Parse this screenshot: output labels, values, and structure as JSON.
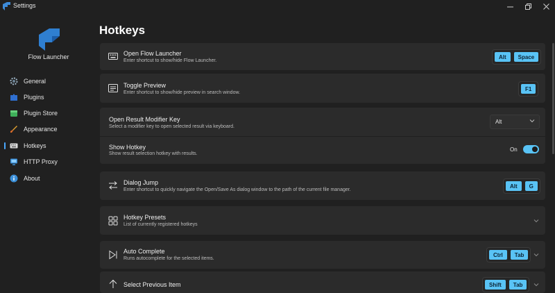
{
  "window": {
    "title": "Settings"
  },
  "sidebar": {
    "app_name": "Flow Launcher",
    "items": [
      {
        "label": "General",
        "icon": "gear-icon"
      },
      {
        "label": "Plugins",
        "icon": "puzzle-icon"
      },
      {
        "label": "Plugin Store",
        "icon": "store-icon"
      },
      {
        "label": "Appearance",
        "icon": "paintbrush-icon"
      },
      {
        "label": "Hotkeys",
        "icon": "keyboard-icon",
        "selected": true
      },
      {
        "label": "HTTP Proxy",
        "icon": "network-icon"
      },
      {
        "label": "About",
        "icon": "info-icon"
      }
    ]
  },
  "page": {
    "title": "Hotkeys"
  },
  "settings": {
    "open_flow": {
      "title": "Open Flow Launcher",
      "desc": "Enter shortcut to show/hide Flow Launcher.",
      "keys": [
        "Alt",
        "Space"
      ]
    },
    "toggle_preview": {
      "title": "Toggle Preview",
      "desc": "Enter shortcut to show/hide preview in search window.",
      "keys": [
        "F1"
      ]
    },
    "open_result_modifier": {
      "title": "Open Result Modifier Key",
      "desc": "Select a modifier key to open selected result via keyboard.",
      "value": "Alt"
    },
    "show_hotkey": {
      "title": "Show Hotkey",
      "desc": "Show result selection hotkey with results.",
      "state_label": "On",
      "enabled": true
    },
    "dialog_jump": {
      "title": "Dialog Jump",
      "desc": "Enter shortcut to quickly navigate the Open/Save As dialog window to the path of the current file manager.",
      "keys": [
        "Alt",
        "G"
      ]
    },
    "hotkey_presets": {
      "title": "Hotkey Presets",
      "desc": "List of currently registered hotkeys"
    },
    "auto_complete": {
      "title": "Auto Complete",
      "desc": "Runs autocomplete for the selected items.",
      "keys": [
        "Ctrl",
        "Tab"
      ]
    },
    "select_previous": {
      "title": "Select Previous Item",
      "keys": [
        "Shift",
        "Tab"
      ]
    }
  },
  "colors": {
    "accent": "#59c3f5",
    "background": "#202020",
    "card": "#2b2b2b"
  }
}
